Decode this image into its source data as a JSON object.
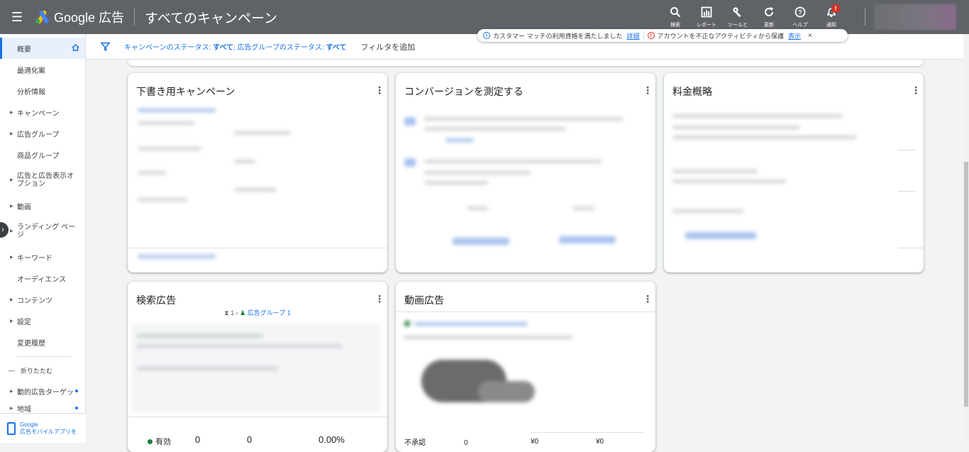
{
  "topbar": {
    "brand": "Google 広告",
    "page_title": "すべてのキャンペーン",
    "actions": [
      {
        "label": "検索",
        "icon": "search-icon",
        "glyph": "🔍"
      },
      {
        "label": "レポート",
        "icon": "report-icon",
        "glyph": "▥"
      },
      {
        "label": "ツールと",
        "icon": "tools-icon",
        "glyph": "🔧"
      },
      {
        "label": "更新",
        "icon": "refresh-icon",
        "glyph": "↻"
      },
      {
        "label": "ヘルプ",
        "icon": "help-icon",
        "glyph": "?"
      },
      {
        "label": "通知",
        "icon": "bell-icon",
        "glyph": "🔔"
      }
    ],
    "notification_badge": "!"
  },
  "sidebar": {
    "items": [
      {
        "label": "概要",
        "active": true,
        "arrow": false
      },
      {
        "label": "最適化案",
        "arrow": false
      },
      {
        "label": "分析情報",
        "arrow": false
      },
      {
        "label": "キャンペーン",
        "arrow": true
      },
      {
        "label": "広告グループ",
        "arrow": true
      },
      {
        "label": "商品グループ",
        "arrow": false
      },
      {
        "label": "広告と広告表示オプション",
        "arrow": true,
        "two": true
      },
      {
        "label": "動画",
        "arrow": true
      },
      {
        "label": "ランディング ページ",
        "arrow": true,
        "two": true
      },
      {
        "label": "キーワード",
        "arrow": true
      },
      {
        "label": "オーディエンス",
        "arrow": false
      },
      {
        "label": "コンテンツ",
        "arrow": true
      },
      {
        "label": "設定",
        "arrow": true
      },
      {
        "label": "変更履歴",
        "arrow": false
      }
    ],
    "collapse_label": "折りたたむ",
    "extra_items": [
      {
        "label": "動的広告ターゲッ"
      },
      {
        "label": "地域"
      }
    ],
    "app_promo_line1": "Google",
    "app_promo_line2": "広告モバイルアプリを"
  },
  "filterbar": {
    "campaign_status_label": "キャンペーンのステータス:",
    "campaign_status_value": "すべて",
    "adgroup_status_label": "広告グループのステータス:",
    "adgroup_status_value": "すべて",
    "add_filter": "フィルタを追加"
  },
  "notice": {
    "message1": "カスタマー マッチの利用資格を満たしました",
    "link1": "詳細",
    "message2": "アカウントを不正なアクティビティから保護",
    "link2": "表示",
    "close": "×"
  },
  "cards": {
    "draft_campaigns": {
      "title": "下書き用キャンペーン"
    },
    "conversions": {
      "title": "コンバージョンを測定する"
    },
    "billing": {
      "title": "料金概略"
    },
    "search_ads": {
      "title": "検索広告",
      "crumb_count": "1",
      "crumb_link": "広告グループ 1",
      "status": "有効",
      "stat1": "0",
      "stat2": "0",
      "stat3": "0.00%"
    },
    "video_ads": {
      "title": "動画広告",
      "status": "不承認",
      "stat1": "0",
      "stat2": "¥0",
      "stat3": "¥0"
    }
  }
}
